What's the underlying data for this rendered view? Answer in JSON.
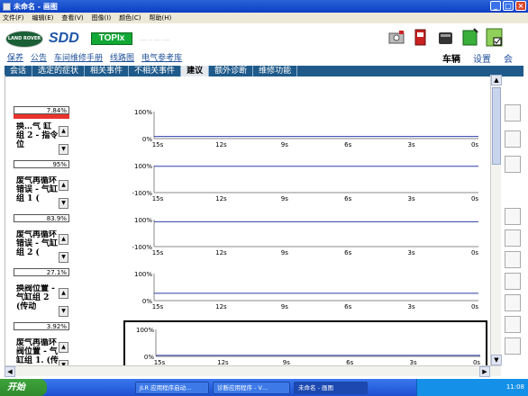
{
  "window": {
    "title": "未命名 - 画图",
    "buttons": {
      "minimize": "_",
      "maximize": "□",
      "close": "×"
    }
  },
  "menu": [
    "文件(F)",
    "编辑(E)",
    "查看(V)",
    "图像(I)",
    "颜色(C)",
    "帮助(H)"
  ],
  "header": {
    "logo_text": "LAND ROVER",
    "app_name": "SDD",
    "topix_label": "TOPIx",
    "faint_links": "‥‥ ‥ ‥‥ ‥‥"
  },
  "nav_links": [
    "保养",
    "公告",
    "车间维修手册",
    "线路图",
    "电气参考库"
  ],
  "vehicle_tabs": [
    {
      "label": "车辆",
      "active": true
    },
    {
      "label": "设置",
      "active": false
    },
    {
      "label": "会",
      "active": false
    }
  ],
  "sub_tabs": [
    {
      "label": "会话",
      "active": false
    },
    {
      "label": "选定的症状",
      "active": false
    },
    {
      "label": "相关事件",
      "active": false
    },
    {
      "label": "不相关事件",
      "active": false
    },
    {
      "label": "建议",
      "active": true
    },
    {
      "label": "额外诊断",
      "active": false
    },
    {
      "label": "维修功能",
      "active": false
    }
  ],
  "signals": [
    {
      "value_text": "7.84%",
      "value_fraction": 0.0784,
      "show_bar": true,
      "label": "换…气 缸组 2 - 指令位",
      "ymax": "100%",
      "ymin": "0%",
      "selected": false
    },
    {
      "value_text": "95%",
      "value_fraction": 0.95,
      "show_bar": false,
      "label": "废气再循环错误 - 气缸组 1 (",
      "ymax": "100%",
      "ymin": "-100%",
      "selected": false
    },
    {
      "value_text": "83.9%",
      "value_fraction": 0.839,
      "show_bar": false,
      "label": "废气再循环错误 - 气缸组 2 (",
      "ymax": "100%",
      "ymin": "-100%",
      "selected": false
    },
    {
      "value_text": "27.1%",
      "value_fraction": 0.271,
      "show_bar": false,
      "label": "换阀位置 - 气缸组 2 (传动",
      "ymax": "100%",
      "ymin": "0%",
      "selected": false
    },
    {
      "value_text": "3.92%",
      "value_fraction": 0.0392,
      "show_bar": false,
      "label": "废气再循环阀位置 - 气缸组 1. (传",
      "ymax": "100%",
      "ymin": "0%",
      "selected": true
    }
  ],
  "x_ticks": [
    "15s",
    "12s",
    "9s",
    "6s",
    "3s",
    "0s"
  ],
  "taskbar": {
    "start_label": "开始",
    "tasks": [
      {
        "label": "JLR 应用程序启动…",
        "active": false
      },
      {
        "label": "诊断应用程序 - V…",
        "active": false
      },
      {
        "label": "未命名 - 画图",
        "active": true
      }
    ],
    "clock": "11:08"
  },
  "colors": {
    "title_blue": "#0a3ec4",
    "tab_strip": "#1f5a8a",
    "trace_blue": "#2d3da8",
    "value_bar_red": "#e8342c",
    "topix_green": "#12a836"
  }
}
